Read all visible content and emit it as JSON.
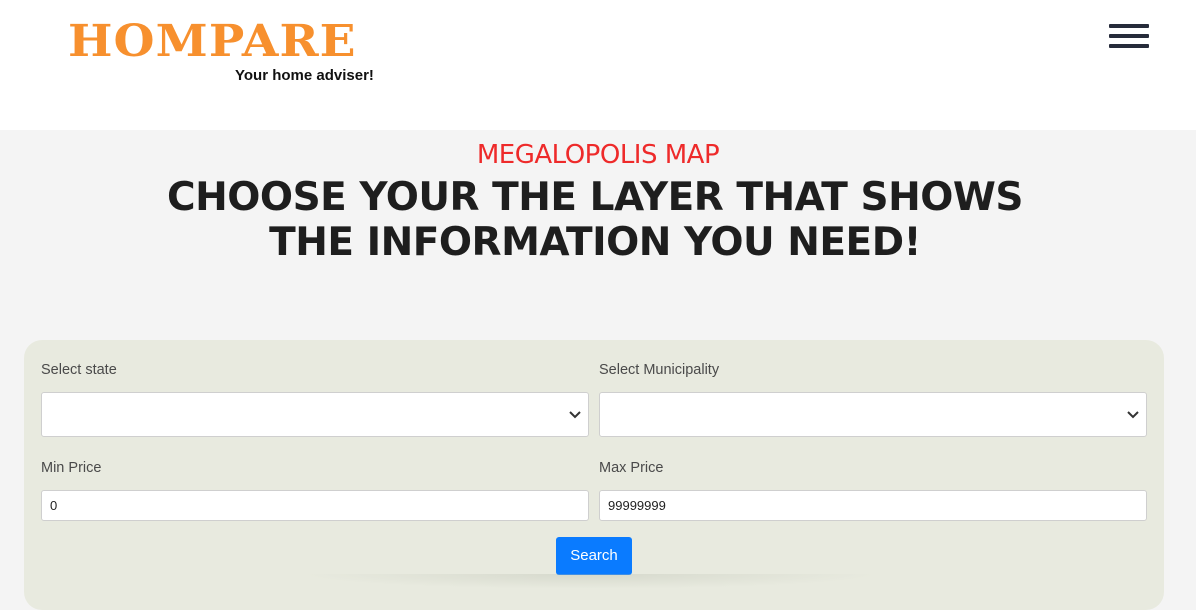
{
  "brand": {
    "logo_text": "HOMPARE",
    "tagline": "Your home adviser!",
    "logo_color": "#f7902e"
  },
  "nav": {
    "menu_icon": "hamburger-menu-icon"
  },
  "hero": {
    "subtitle": "MEGALOPOLIS MAP",
    "headline": "CHOOSE YOUR THE LAYER THAT SHOWS THE INFORMATION YOU NEED!",
    "subtitle_color": "#ee2a2a"
  },
  "filters": {
    "state_label": "Select state",
    "state_value": "",
    "municipality_label": "Select Municipality",
    "municipality_value": "",
    "min_price_label": "Min Price",
    "min_price_value": "0",
    "max_price_label": "Max Price",
    "max_price_value": "99999999",
    "search_label": "Search",
    "accent_color": "#0a7bff"
  }
}
